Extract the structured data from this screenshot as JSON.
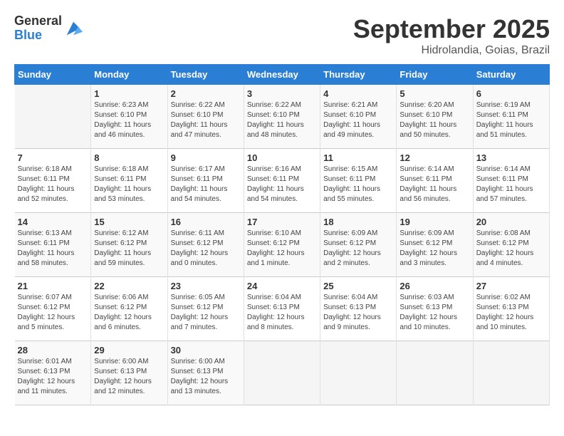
{
  "logo": {
    "general": "General",
    "blue": "Blue"
  },
  "title": "September 2025",
  "location": "Hidrolandia, Goias, Brazil",
  "days_of_week": [
    "Sunday",
    "Monday",
    "Tuesday",
    "Wednesday",
    "Thursday",
    "Friday",
    "Saturday"
  ],
  "weeks": [
    [
      {
        "day": "",
        "sunrise": "",
        "sunset": "",
        "daylight": ""
      },
      {
        "day": "1",
        "sunrise": "Sunrise: 6:23 AM",
        "sunset": "Sunset: 6:10 PM",
        "daylight": "Daylight: 11 hours and 46 minutes."
      },
      {
        "day": "2",
        "sunrise": "Sunrise: 6:22 AM",
        "sunset": "Sunset: 6:10 PM",
        "daylight": "Daylight: 11 hours and 47 minutes."
      },
      {
        "day": "3",
        "sunrise": "Sunrise: 6:22 AM",
        "sunset": "Sunset: 6:10 PM",
        "daylight": "Daylight: 11 hours and 48 minutes."
      },
      {
        "day": "4",
        "sunrise": "Sunrise: 6:21 AM",
        "sunset": "Sunset: 6:10 PM",
        "daylight": "Daylight: 11 hours and 49 minutes."
      },
      {
        "day": "5",
        "sunrise": "Sunrise: 6:20 AM",
        "sunset": "Sunset: 6:10 PM",
        "daylight": "Daylight: 11 hours and 50 minutes."
      },
      {
        "day": "6",
        "sunrise": "Sunrise: 6:19 AM",
        "sunset": "Sunset: 6:11 PM",
        "daylight": "Daylight: 11 hours and 51 minutes."
      }
    ],
    [
      {
        "day": "7",
        "sunrise": "Sunrise: 6:18 AM",
        "sunset": "Sunset: 6:11 PM",
        "daylight": "Daylight: 11 hours and 52 minutes."
      },
      {
        "day": "8",
        "sunrise": "Sunrise: 6:18 AM",
        "sunset": "Sunset: 6:11 PM",
        "daylight": "Daylight: 11 hours and 53 minutes."
      },
      {
        "day": "9",
        "sunrise": "Sunrise: 6:17 AM",
        "sunset": "Sunset: 6:11 PM",
        "daylight": "Daylight: 11 hours and 54 minutes."
      },
      {
        "day": "10",
        "sunrise": "Sunrise: 6:16 AM",
        "sunset": "Sunset: 6:11 PM",
        "daylight": "Daylight: 11 hours and 54 minutes."
      },
      {
        "day": "11",
        "sunrise": "Sunrise: 6:15 AM",
        "sunset": "Sunset: 6:11 PM",
        "daylight": "Daylight: 11 hours and 55 minutes."
      },
      {
        "day": "12",
        "sunrise": "Sunrise: 6:14 AM",
        "sunset": "Sunset: 6:11 PM",
        "daylight": "Daylight: 11 hours and 56 minutes."
      },
      {
        "day": "13",
        "sunrise": "Sunrise: 6:14 AM",
        "sunset": "Sunset: 6:11 PM",
        "daylight": "Daylight: 11 hours and 57 minutes."
      }
    ],
    [
      {
        "day": "14",
        "sunrise": "Sunrise: 6:13 AM",
        "sunset": "Sunset: 6:11 PM",
        "daylight": "Daylight: 11 hours and 58 minutes."
      },
      {
        "day": "15",
        "sunrise": "Sunrise: 6:12 AM",
        "sunset": "Sunset: 6:12 PM",
        "daylight": "Daylight: 11 hours and 59 minutes."
      },
      {
        "day": "16",
        "sunrise": "Sunrise: 6:11 AM",
        "sunset": "Sunset: 6:12 PM",
        "daylight": "Daylight: 12 hours and 0 minutes."
      },
      {
        "day": "17",
        "sunrise": "Sunrise: 6:10 AM",
        "sunset": "Sunset: 6:12 PM",
        "daylight": "Daylight: 12 hours and 1 minute."
      },
      {
        "day": "18",
        "sunrise": "Sunrise: 6:09 AM",
        "sunset": "Sunset: 6:12 PM",
        "daylight": "Daylight: 12 hours and 2 minutes."
      },
      {
        "day": "19",
        "sunrise": "Sunrise: 6:09 AM",
        "sunset": "Sunset: 6:12 PM",
        "daylight": "Daylight: 12 hours and 3 minutes."
      },
      {
        "day": "20",
        "sunrise": "Sunrise: 6:08 AM",
        "sunset": "Sunset: 6:12 PM",
        "daylight": "Daylight: 12 hours and 4 minutes."
      }
    ],
    [
      {
        "day": "21",
        "sunrise": "Sunrise: 6:07 AM",
        "sunset": "Sunset: 6:12 PM",
        "daylight": "Daylight: 12 hours and 5 minutes."
      },
      {
        "day": "22",
        "sunrise": "Sunrise: 6:06 AM",
        "sunset": "Sunset: 6:12 PM",
        "daylight": "Daylight: 12 hours and 6 minutes."
      },
      {
        "day": "23",
        "sunrise": "Sunrise: 6:05 AM",
        "sunset": "Sunset: 6:12 PM",
        "daylight": "Daylight: 12 hours and 7 minutes."
      },
      {
        "day": "24",
        "sunrise": "Sunrise: 6:04 AM",
        "sunset": "Sunset: 6:13 PM",
        "daylight": "Daylight: 12 hours and 8 minutes."
      },
      {
        "day": "25",
        "sunrise": "Sunrise: 6:04 AM",
        "sunset": "Sunset: 6:13 PM",
        "daylight": "Daylight: 12 hours and 9 minutes."
      },
      {
        "day": "26",
        "sunrise": "Sunrise: 6:03 AM",
        "sunset": "Sunset: 6:13 PM",
        "daylight": "Daylight: 12 hours and 10 minutes."
      },
      {
        "day": "27",
        "sunrise": "Sunrise: 6:02 AM",
        "sunset": "Sunset: 6:13 PM",
        "daylight": "Daylight: 12 hours and 10 minutes."
      }
    ],
    [
      {
        "day": "28",
        "sunrise": "Sunrise: 6:01 AM",
        "sunset": "Sunset: 6:13 PM",
        "daylight": "Daylight: 12 hours and 11 minutes."
      },
      {
        "day": "29",
        "sunrise": "Sunrise: 6:00 AM",
        "sunset": "Sunset: 6:13 PM",
        "daylight": "Daylight: 12 hours and 12 minutes."
      },
      {
        "day": "30",
        "sunrise": "Sunrise: 6:00 AM",
        "sunset": "Sunset: 6:13 PM",
        "daylight": "Daylight: 12 hours and 13 minutes."
      },
      {
        "day": "",
        "sunrise": "",
        "sunset": "",
        "daylight": ""
      },
      {
        "day": "",
        "sunrise": "",
        "sunset": "",
        "daylight": ""
      },
      {
        "day": "",
        "sunrise": "",
        "sunset": "",
        "daylight": ""
      },
      {
        "day": "",
        "sunrise": "",
        "sunset": "",
        "daylight": ""
      }
    ]
  ]
}
